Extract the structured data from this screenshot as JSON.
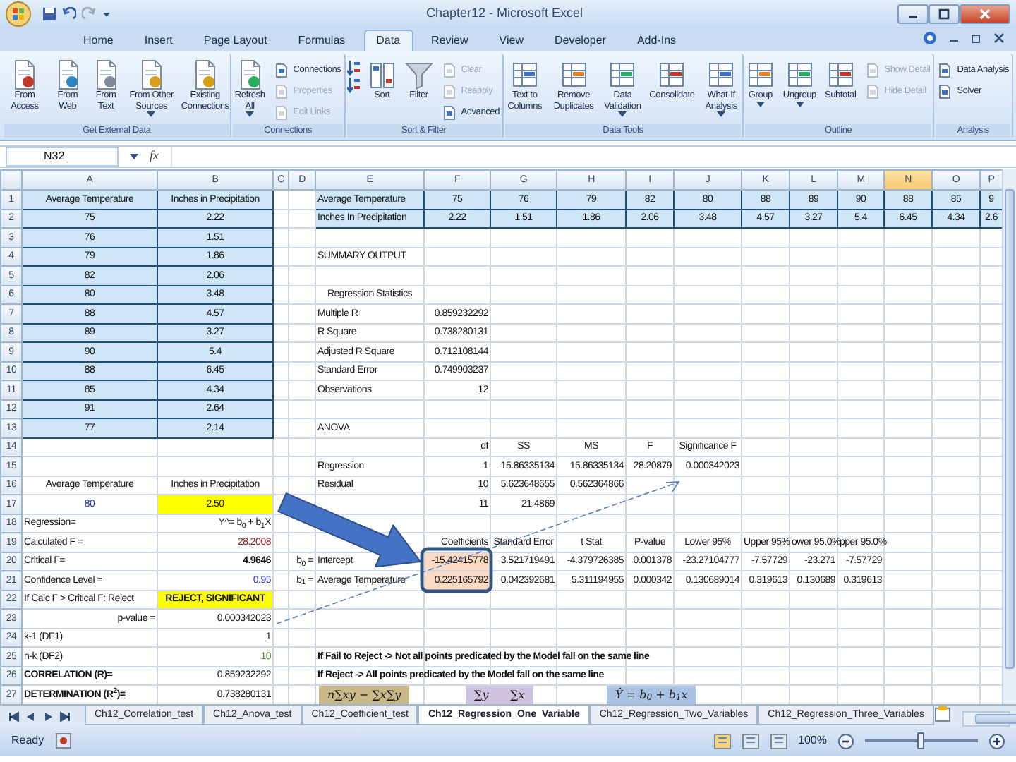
{
  "window": {
    "title": "Chapter12 - Microsoft Excel"
  },
  "ribbon_tabs": [
    {
      "label": "Home",
      "selected": false
    },
    {
      "label": "Insert",
      "selected": false
    },
    {
      "label": "Page Layout",
      "selected": false
    },
    {
      "label": "Formulas",
      "selected": false
    },
    {
      "label": "Data",
      "selected": true
    },
    {
      "label": "Review",
      "selected": false
    },
    {
      "label": "View",
      "selected": false
    },
    {
      "label": "Developer",
      "selected": false
    },
    {
      "label": "Add-Ins",
      "selected": false
    }
  ],
  "ribbon_groups": [
    {
      "label": "Get External Data",
      "items": [
        {
          "kind": "large",
          "label": "From Access"
        },
        {
          "kind": "large",
          "label": "From Web"
        },
        {
          "kind": "large",
          "label": "From Text"
        },
        {
          "kind": "large",
          "label": "From Other Sources",
          "dropdown": true
        },
        {
          "kind": "large",
          "label": "Existing Connections"
        }
      ]
    },
    {
      "label": "Connections",
      "items": [
        {
          "kind": "large",
          "label": "Refresh All",
          "dropdown": true
        },
        {
          "kind": "small",
          "label": "Connections"
        },
        {
          "kind": "small",
          "label": "Properties",
          "disabled": true
        },
        {
          "kind": "small",
          "label": "Edit Links",
          "disabled": true
        }
      ]
    },
    {
      "label": "Sort & Filter",
      "items": [
        {
          "kind": "icon"
        },
        {
          "kind": "icon"
        },
        {
          "kind": "large",
          "label": "Sort"
        },
        {
          "kind": "large",
          "label": "Filter"
        },
        {
          "kind": "small",
          "label": "Clear",
          "disabled": true
        },
        {
          "kind": "small",
          "label": "Reapply",
          "disabled": true
        },
        {
          "kind": "small",
          "label": "Advanced"
        }
      ]
    },
    {
      "label": "Data Tools",
      "items": [
        {
          "kind": "large",
          "label": "Text to Columns"
        },
        {
          "kind": "large",
          "label": "Remove Duplicates"
        },
        {
          "kind": "large",
          "label": "Data Validation",
          "dropdown": true
        },
        {
          "kind": "large",
          "label": "Consolidate"
        },
        {
          "kind": "large",
          "label": "What-If Analysis",
          "dropdown": true
        }
      ]
    },
    {
      "label": "Outline",
      "items": [
        {
          "kind": "large",
          "label": "Group",
          "dropdown": true
        },
        {
          "kind": "large",
          "label": "Ungroup",
          "dropdown": true
        },
        {
          "kind": "large",
          "label": "Subtotal"
        },
        {
          "kind": "small",
          "label": "Show Detail",
          "disabled": true
        },
        {
          "kind": "small",
          "label": "Hide Detail",
          "disabled": true
        }
      ]
    },
    {
      "label": "Analysis",
      "items": [
        {
          "kind": "small",
          "label": "Data Analysis"
        },
        {
          "kind": "small",
          "label": "Solver"
        }
      ]
    }
  ],
  "formula_bar": {
    "name_box": "N32",
    "function_label": "fx"
  },
  "columns": [
    {
      "label": "A",
      "selected": false
    },
    {
      "label": "B",
      "selected": false
    },
    {
      "label": "C",
      "selected": false
    },
    {
      "label": "D",
      "selected": false
    },
    {
      "label": "E",
      "selected": false
    },
    {
      "label": "F",
      "selected": false
    },
    {
      "label": "G",
      "selected": false
    },
    {
      "label": "H",
      "selected": false
    },
    {
      "label": "I",
      "selected": false
    },
    {
      "label": "J",
      "selected": false
    },
    {
      "label": "K",
      "selected": false
    },
    {
      "label": "L",
      "selected": false
    },
    {
      "label": "M",
      "selected": false
    },
    {
      "label": "N",
      "selected": true
    },
    {
      "label": "O",
      "selected": false
    },
    {
      "label": "P",
      "selected": false
    }
  ],
  "rows": [
    {
      "label": "1",
      "cells": [
        {
          "text": "Average Temperature",
          "kind": "band",
          "centered": true
        },
        {
          "text": "Inches in Precipitation",
          "kind": "band",
          "centered": true
        },
        null,
        null,
        {
          "text": "Average Temperature",
          "kind": "band"
        },
        {
          "text": "75",
          "kind": "band",
          "centered": true
        },
        {
          "text": "76",
          "kind": "band",
          "centered": true
        },
        {
          "text": "79",
          "kind": "band",
          "centered": true
        },
        {
          "text": "82",
          "kind": "band",
          "centered": true
        },
        {
          "text": "80",
          "kind": "band",
          "centered": true
        },
        {
          "text": "88",
          "kind": "band",
          "centered": true
        },
        {
          "text": "89",
          "kind": "band",
          "centered": true
        },
        {
          "text": "90",
          "kind": "band",
          "centered": true
        },
        {
          "text": "88",
          "kind": "band",
          "centered": true
        },
        {
          "text": "85",
          "kind": "band",
          "centered": true
        },
        {
          "text": "9",
          "kind": "band",
          "centered": true
        }
      ]
    },
    {
      "label": "2",
      "cells": [
        {
          "text": "75",
          "kind": "band",
          "centered": true
        },
        {
          "text": "2.22",
          "kind": "band",
          "centered": true
        },
        null,
        null,
        {
          "text": "Inches In Precipitation",
          "kind": "band"
        },
        {
          "text": "2.22",
          "kind": "band",
          "centered": true
        },
        {
          "text": "1.51",
          "kind": "band",
          "centered": true
        },
        {
          "text": "1.86",
          "kind": "band",
          "centered": true
        },
        {
          "text": "2.06",
          "kind": "band",
          "centered": true
        },
        {
          "text": "3.48",
          "kind": "band",
          "centered": true
        },
        {
          "text": "4.57",
          "kind": "band",
          "centered": true
        },
        {
          "text": "3.27",
          "kind": "band",
          "centered": true
        },
        {
          "text": "5.4",
          "kind": "band",
          "centered": true
        },
        {
          "text": "6.45",
          "kind": "band",
          "centered": true
        },
        {
          "text": "4.34",
          "kind": "band",
          "centered": true
        },
        {
          "text": "2.6",
          "kind": "band",
          "centered": true
        }
      ]
    },
    {
      "label": "3",
      "cells": [
        {
          "text": "76",
          "kind": "band",
          "centered": true
        },
        {
          "text": "1.51",
          "kind": "band",
          "centered": true
        }
      ]
    },
    {
      "label": "4",
      "cells": [
        {
          "text": "79",
          "kind": "band",
          "centered": true
        },
        {
          "text": "1.86",
          "kind": "band",
          "centered": true
        },
        null,
        null,
        {
          "text": "SUMMARY OUTPUT"
        }
      ]
    },
    {
      "label": "5",
      "cells": [
        {
          "text": "82",
          "kind": "band",
          "centered": true
        },
        {
          "text": "2.06",
          "kind": "band",
          "centered": true
        }
      ]
    },
    {
      "label": "6",
      "cells": [
        {
          "text": "80",
          "kind": "band",
          "centered": true
        },
        {
          "text": "3.48",
          "kind": "band",
          "centered": true
        },
        null,
        null,
        {
          "text": "Regression Statistics",
          "centered": true
        }
      ]
    },
    {
      "label": "7",
      "cells": [
        {
          "text": "88",
          "kind": "band",
          "centered": true
        },
        {
          "text": "4.57",
          "kind": "band",
          "centered": true
        },
        null,
        null,
        {
          "text": "Multiple R"
        },
        {
          "text": "0.859232292",
          "right_aligned": true
        }
      ]
    },
    {
      "label": "8",
      "cells": [
        {
          "text": "89",
          "kind": "band",
          "centered": true
        },
        {
          "text": "3.27",
          "kind": "band",
          "centered": true
        },
        null,
        null,
        {
          "text": "R Square"
        },
        {
          "text": "0.738280131",
          "right_aligned": true
        }
      ]
    },
    {
      "label": "9",
      "cells": [
        {
          "text": "90",
          "kind": "band",
          "centered": true
        },
        {
          "text": "5.4",
          "kind": "band",
          "centered": true
        },
        null,
        null,
        {
          "text": "Adjusted R Square"
        },
        {
          "text": "0.712108144",
          "right_aligned": true
        }
      ]
    },
    {
      "label": "10",
      "cells": [
        {
          "text": "88",
          "kind": "band",
          "centered": true
        },
        {
          "text": "6.45",
          "kind": "band",
          "centered": true
        },
        null,
        null,
        {
          "text": "Standard Error"
        },
        {
          "text": "0.749903237",
          "right_aligned": true
        }
      ]
    },
    {
      "label": "11",
      "cells": [
        {
          "text": "85",
          "kind": "band",
          "centered": true
        },
        {
          "text": "4.34",
          "kind": "band",
          "centered": true
        },
        null,
        null,
        {
          "text": "Observations"
        },
        {
          "text": "12",
          "right_aligned": true
        }
      ]
    },
    {
      "label": "12",
      "cells": [
        {
          "text": "91",
          "kind": "band",
          "centered": true
        },
        {
          "text": "2.64",
          "kind": "band",
          "centered": true
        }
      ]
    },
    {
      "label": "13",
      "cells": [
        {
          "text": "77",
          "kind": "band",
          "centered": true
        },
        {
          "text": "2.14",
          "kind": "band",
          "centered": true
        },
        null,
        null,
        {
          "text": "ANOVA"
        }
      ]
    },
    {
      "label": "14",
      "cells": [
        null,
        null,
        null,
        null,
        null,
        {
          "text": "df",
          "right_aligned": true
        },
        {
          "text": "SS",
          "centered": true
        },
        {
          "text": "MS",
          "centered": true
        },
        {
          "text": "F",
          "centered": true
        },
        {
          "text": "Significance F",
          "centered": true
        }
      ]
    },
    {
      "label": "15",
      "cells": [
        null,
        null,
        null,
        null,
        {
          "text": "Regression"
        },
        {
          "text": "1",
          "right_aligned": true
        },
        {
          "text": "15.86335134",
          "right_aligned": true
        },
        {
          "text": "15.86335134",
          "right_aligned": true
        },
        {
          "text": "28.20879",
          "right_aligned": true
        },
        {
          "text": "0.000342023",
          "right_aligned": true
        }
      ]
    },
    {
      "label": "16",
      "cells": [
        {
          "text": "Average Temperature",
          "centered": true
        },
        {
          "text": "Inches in Precipitation",
          "centered": true
        },
        null,
        null,
        {
          "text": "Residual"
        },
        {
          "text": "10",
          "right_aligned": true
        },
        {
          "text": "5.623648655",
          "right_aligned": true
        },
        {
          "text": "0.562364866",
          "right_aligned": true
        }
      ]
    },
    {
      "label": "17",
      "cells": [
        {
          "text": "80",
          "centered": true,
          "color": "#1f2fbf"
        },
        {
          "text": "2.50",
          "kind": "highlight",
          "centered": true
        },
        null,
        null,
        null,
        {
          "text": "11",
          "right_aligned": true
        },
        {
          "text": "21.4869",
          "right_aligned": true
        }
      ]
    },
    {
      "label": "18",
      "cells": [
        {
          "text": "Regression="
        },
        {
          "text": "Y^= b$_{0}$ + b$_{1}$X",
          "right_aligned": true
        }
      ]
    },
    {
      "label": "19",
      "cells": [
        {
          "text": "Calculated F ="
        },
        {
          "text": "28.2008",
          "right_aligned": true,
          "color": "#8b1a1a"
        },
        null,
        null,
        null,
        {
          "text": "Coefficients",
          "right_aligned": true
        },
        {
          "text": "Standard Error",
          "centered": true
        },
        {
          "text": "t Stat",
          "centered": true
        },
        {
          "text": "P-value",
          "centered": true
        },
        {
          "text": "Lower 95%",
          "centered": true
        },
        {
          "text": "Upper 95%",
          "centered": true
        },
        {
          "text": "ower 95.0%",
          "centered": true
        },
        {
          "text": "pper 95.0%",
          "centered": true
        }
      ]
    },
    {
      "label": "20",
      "cells": [
        {
          "text": "Critical F="
        },
        {
          "text": "4.9646",
          "right_aligned": true,
          "bold": true
        },
        null,
        {
          "text": "b$_{0}$ =",
          "right_aligned": true
        },
        {
          "text": "Intercept"
        },
        {
          "text": "-15.42415778",
          "kind": "coef",
          "right_aligned": true
        },
        {
          "text": "3.521719491",
          "right_aligned": true
        },
        {
          "text": "-4.379726385",
          "right_aligned": true
        },
        {
          "text": "0.001378",
          "right_aligned": true
        },
        {
          "text": "-23.27104777",
          "right_aligned": true
        },
        {
          "text": "-7.57729",
          "right_aligned": true
        },
        {
          "text": "-23.271",
          "right_aligned": true
        },
        {
          "text": "-7.57729",
          "right_aligned": true
        }
      ]
    },
    {
      "label": "21",
      "cells": [
        {
          "text": "Confidence Level ="
        },
        {
          "text": "0.95",
          "right_aligned": true,
          "color": "#1f2fbf"
        },
        null,
        {
          "text": "b$_{1}$ =",
          "right_aligned": true
        },
        {
          "text": "Average Temperature"
        },
        {
          "text": "0.225165792",
          "kind": "coef",
          "right_aligned": true
        },
        {
          "text": "0.042392681",
          "right_aligned": true
        },
        {
          "text": "5.311194955",
          "right_aligned": true
        },
        {
          "text": "0.000342",
          "right_aligned": true
        },
        {
          "text": "0.130689014",
          "right_aligned": true
        },
        {
          "text": "0.319613",
          "right_aligned": true
        },
        {
          "text": "0.130689",
          "right_aligned": true
        },
        {
          "text": "0.319613",
          "right_aligned": true
        }
      ]
    },
    {
      "label": "22",
      "cells": [
        {
          "text": "If Calc F > Critical F: Reject"
        },
        {
          "text": "REJECT, SIGNIFICANT",
          "kind": "highlight",
          "centered": true,
          "bold": true
        }
      ]
    },
    {
      "label": "23",
      "cells": [
        {
          "text": "p-value =",
          "right_aligned": true
        },
        {
          "text": "0.000342023",
          "right_aligned": true
        }
      ]
    },
    {
      "label": "24",
      "cells": [
        {
          "text": "k-1 (DF1)"
        },
        {
          "text": "1",
          "right_aligned": true
        }
      ]
    },
    {
      "label": "25",
      "cells": [
        {
          "text": "n-k (DF2)"
        },
        {
          "text": "10",
          "right_aligned": true,
          "color": "#4f8a3a"
        },
        null,
        null,
        {
          "text": "If Fail to Reject -> Not all points predicated by the Model fall on the same line",
          "bold": true
        }
      ]
    },
    {
      "label": "26",
      "cells": [
        {
          "text": "CORRELATION (R)=",
          "bold": true
        },
        {
          "text": "0.859232292",
          "right_aligned": true
        },
        null,
        null,
        {
          "text": "If Reject -> All points predicated by the Model fall on the same line",
          "bold": true
        }
      ]
    },
    {
      "label": "27",
      "cells": [
        {
          "text": "DETERMINATION (R$^{2}$)=",
          "bold": true
        },
        {
          "text": "0.738280131",
          "right_aligned": true
        }
      ]
    }
  ],
  "equations": [
    {
      "text": "n∑xy − ∑x∑y",
      "color": "#c9b98a"
    },
    {
      "text": "∑y      ∑x",
      "color": "#cfc3e0"
    },
    {
      "text": "Ŷ = b$_{0}$ + b$_{1}$x",
      "color": "#a9c1e2"
    }
  ],
  "sheet_tabs": [
    {
      "label": "Ch12_Correlation_test",
      "selected": false
    },
    {
      "label": "Ch12_Anova_test",
      "selected": false
    },
    {
      "label": "Ch12_Coefficient_test",
      "selected": false
    },
    {
      "label": "Ch12_Regression_One_Variable",
      "selected": true
    },
    {
      "label": "Ch12_Regression_Two_Variables",
      "selected": false
    },
    {
      "label": "Ch12_Regression_Three_Variables",
      "selected": false
    }
  ],
  "status_bar": {
    "text": "Ready",
    "zoom": {
      "reading": "100%",
      "level": 0.5
    }
  }
}
